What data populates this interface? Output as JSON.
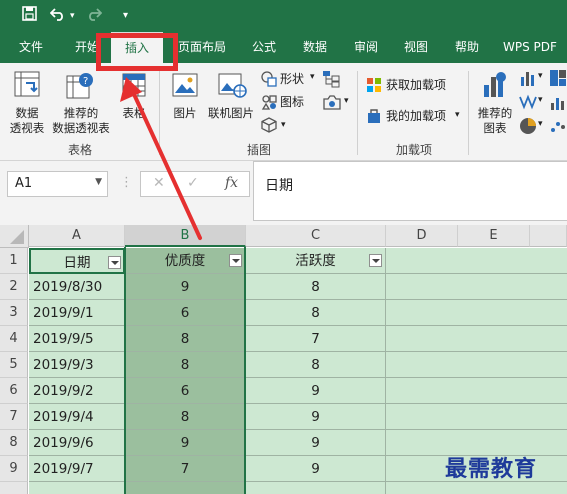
{
  "quick_access": {
    "undo_sep": "▾",
    "customize": "▾"
  },
  "tabs": [
    {
      "label": "文件"
    },
    {
      "label": "开始"
    },
    {
      "label": "插入"
    },
    {
      "label": "页面布局"
    },
    {
      "label": "公式"
    },
    {
      "label": "数据"
    },
    {
      "label": "审阅"
    },
    {
      "label": "视图"
    },
    {
      "label": "帮助"
    },
    {
      "label": "WPS PDF"
    }
  ],
  "active_tab": "插入",
  "ribbon": {
    "tables": {
      "pivot_line1": "数据",
      "pivot_line2": "透视表",
      "rec_line1": "推荐的",
      "rec_line2": "数据透视表",
      "table": "表格",
      "group": "表格"
    },
    "illustrations": {
      "picture": "图片",
      "online_picture": "联机图片",
      "shapes": "形状",
      "icons": "图标",
      "group": "插图"
    },
    "addins": {
      "get": "获取加载项",
      "mine": "我的加载项",
      "group": "加载项"
    },
    "charts": {
      "rec_line1": "推荐的",
      "rec_line2": "图表"
    }
  },
  "formula_bar": {
    "name_box": "A1",
    "cancel": "✕",
    "enter": "✓",
    "fx": "fx",
    "content": "日期"
  },
  "columns": [
    "A",
    "B",
    "C",
    "D",
    "E"
  ],
  "headers": {
    "date": "日期",
    "quality": "优质度",
    "activity": "活跃度"
  },
  "rows": [
    {
      "num": "1"
    },
    {
      "num": "2",
      "date": "2019/8/30",
      "quality": "9",
      "activity": "8"
    },
    {
      "num": "3",
      "date": "2019/9/1",
      "quality": "6",
      "activity": "8"
    },
    {
      "num": "4",
      "date": "2019/9/5",
      "quality": "8",
      "activity": "7"
    },
    {
      "num": "5",
      "date": "2019/9/3",
      "quality": "8",
      "activity": "8"
    },
    {
      "num": "6",
      "date": "2019/9/2",
      "quality": "6",
      "activity": "9"
    },
    {
      "num": "7",
      "date": "2019/9/4",
      "quality": "8",
      "activity": "9"
    },
    {
      "num": "8",
      "date": "2019/9/6",
      "quality": "9",
      "activity": "9"
    },
    {
      "num": "9",
      "date": "2019/9/7",
      "quality": "7",
      "activity": "9"
    }
  ],
  "watermark": "最需教育",
  "colors": {
    "excel_green": "#217346",
    "annotation_red": "#e53030",
    "selection_fill": "#9bbf9e"
  }
}
